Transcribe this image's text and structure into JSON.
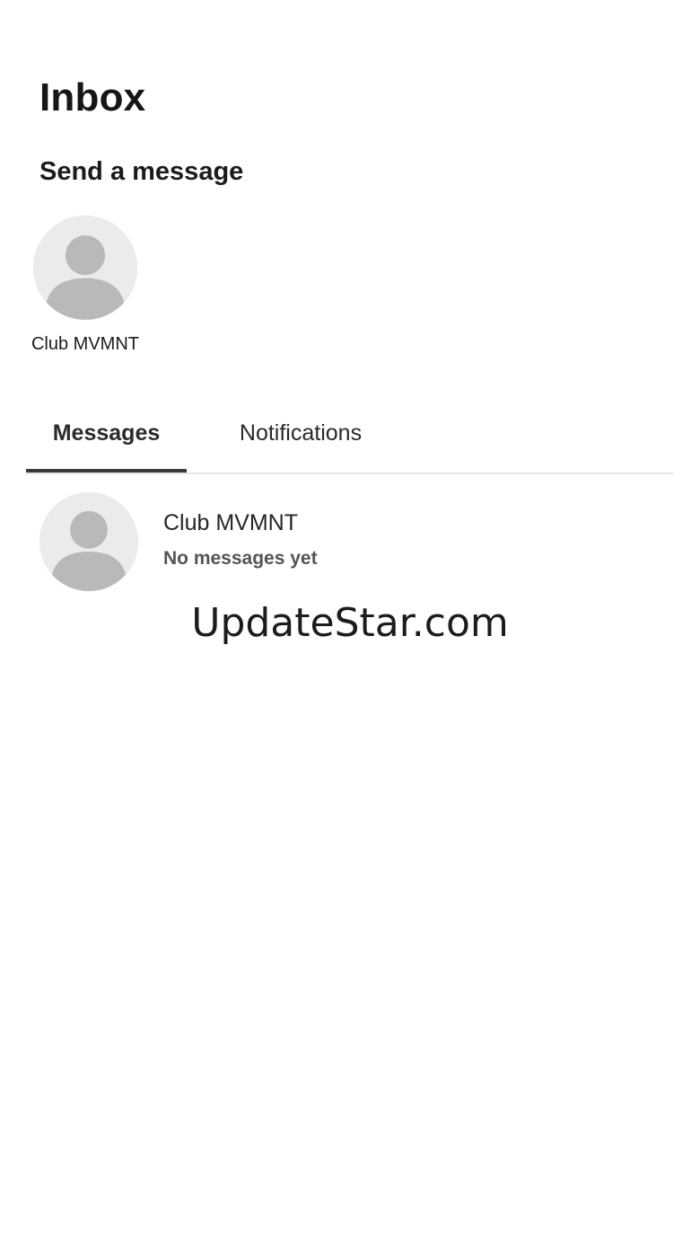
{
  "header": {
    "title": "Inbox"
  },
  "send_section": {
    "title": "Send a message",
    "contacts": [
      {
        "name": "Club MVMNT",
        "avatar_icon": "default-avatar-icon"
      }
    ]
  },
  "tabs": [
    {
      "label": "Messages",
      "active": true
    },
    {
      "label": "Notifications",
      "active": false
    }
  ],
  "conversations": [
    {
      "name": "Club MVMNT",
      "preview": "No messages yet",
      "avatar_icon": "default-avatar-icon"
    }
  ],
  "watermark": "UpdateStar.com",
  "colors": {
    "background": "#ffffff",
    "avatar_background": "#e9e9ea",
    "avatar_silhouette": "#b9b9bb",
    "active_tab_indicator": "#3a3a3a"
  }
}
